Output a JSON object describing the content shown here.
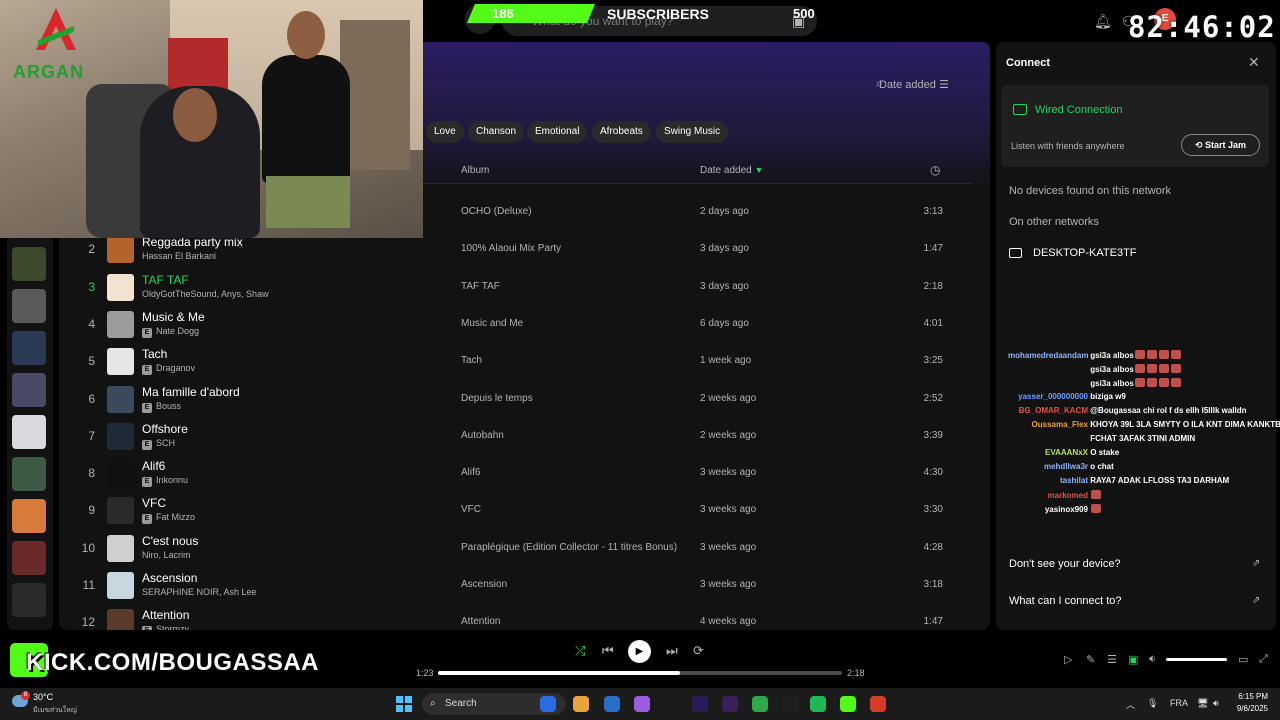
{
  "search": {
    "placeholder": "What do you want to play?"
  },
  "library_thumbs": [
    "#3b4a2a",
    "#5a5a5a",
    "#2c3b55",
    "#4a4a66",
    "#d9d9e0",
    "#3d5a45",
    "#d87a3a",
    "#6a2a2a",
    "#2a2a2a"
  ],
  "main": {
    "sort_label": "Date added",
    "chips": [
      "Love",
      "Chanson",
      "Emotional",
      "Afrobeats",
      "Swing Music"
    ],
    "columns": {
      "album": "Album",
      "date_added": "Date added"
    },
    "tracks": [
      {
        "num": "1",
        "title": "",
        "artist": "",
        "explicit": false,
        "album": "OCHO (Deluxe)",
        "added": "2 days ago",
        "duration": "3:13",
        "cover": "#555"
      },
      {
        "num": "2",
        "title": "Reggada party mix",
        "artist": "Hassan El Barkani",
        "explicit": false,
        "album": "100% Alaoui Mix Party",
        "added": "3 days ago",
        "duration": "1:47",
        "cover": "#b3642a"
      },
      {
        "num": "3",
        "title": "TAF TAF",
        "artist": "OldyGotTheSound, Anys, Shaw",
        "explicit": false,
        "album": "TAF TAF",
        "added": "3 days ago",
        "duration": "2:18",
        "cover": "#f2e2d0",
        "playing": true
      },
      {
        "num": "4",
        "title": "Music & Me",
        "artist": "Nate Dogg",
        "explicit": true,
        "album": "Music and Me",
        "added": "6 days ago",
        "duration": "4:01",
        "cover": "#9b9b9b"
      },
      {
        "num": "5",
        "title": "Tach",
        "artist": "Draganov",
        "explicit": true,
        "album": "Tach",
        "added": "1 week ago",
        "duration": "3:25",
        "cover": "#e6e6e6"
      },
      {
        "num": "6",
        "title": "Ma famille d'abord",
        "artist": "Bouss",
        "explicit": true,
        "album": "Depuis le temps",
        "added": "2 weeks ago",
        "duration": "2:52",
        "cover": "#3a4a5a"
      },
      {
        "num": "7",
        "title": "Offshore",
        "artist": "SCH",
        "explicit": true,
        "album": "Autobahn",
        "added": "2 weeks ago",
        "duration": "3:39",
        "cover": "#1e2a36"
      },
      {
        "num": "8",
        "title": "Alif6",
        "artist": "Inkonnu",
        "explicit": true,
        "album": "Alif6",
        "added": "3 weeks ago",
        "duration": "4:30",
        "cover": "#111111"
      },
      {
        "num": "9",
        "title": "VFC",
        "artist": "Fat Mizzo",
        "explicit": true,
        "album": "VFC",
        "added": "3 weeks ago",
        "duration": "3:30",
        "cover": "#2a2a2a"
      },
      {
        "num": "10",
        "title": "C'est nous",
        "artist": "Niro, Lacrim",
        "explicit": false,
        "album": "Paraplégique (Edition Collector - 11 titres Bonus)",
        "added": "3 weeks ago",
        "duration": "4:28",
        "cover": "#d0d0d0"
      },
      {
        "num": "11",
        "title": "Ascension",
        "artist": "SERAPHINE NOIR, Ash Lee",
        "explicit": false,
        "album": "Ascension",
        "added": "3 weeks ago",
        "duration": "3:18",
        "cover": "#c8d6e0"
      },
      {
        "num": "12",
        "title": "Attention",
        "artist": "Stormzy",
        "explicit": true,
        "album": "Attention",
        "added": "4 weeks ago",
        "duration": "1:47",
        "cover": "#5a3a2a"
      }
    ]
  },
  "connect": {
    "title": "Connect",
    "wired": "Wired Connection",
    "listen": "Listen with friends anywhere",
    "jam": "Start Jam",
    "no_devices": "No devices found on this network",
    "other": "On other networks",
    "device": "DESKTOP-KATE3TF",
    "help1": "Don't see your device?",
    "help2": "What can I connect to?"
  },
  "chat": [
    {
      "user": "mohamedredaandam",
      "color": "#8fb4ff",
      "text": "gsi3a albos",
      "emotes": 4
    },
    {
      "user": "",
      "color": "#8fb4ff",
      "text": "gsi3a albos",
      "emotes": 4
    },
    {
      "user": "",
      "color": "#8fb4ff",
      "text": "gsi3a albos",
      "emotes": 4
    },
    {
      "user": "yasser_000000000",
      "color": "#6aa0ff",
      "text": "biziga w9",
      "emotes": 0
    },
    {
      "user": "BG_OMAR_KACM",
      "color": "#e0524b",
      "text": "@Bougassaa chi rol f ds ellh l5lllk walldn",
      "emotes": 0
    },
    {
      "user": "Oussama_Flex",
      "color": "#f0a030",
      "text": "KHOYA 39L 3LA SMYTY O ILA KNT DIMA KANKTB",
      "emotes": 0
    },
    {
      "user": "",
      "color": "#f0a030",
      "text": "FCHAT 3AFAK 3TINI ADMIN",
      "emotes": 0
    },
    {
      "user": "EVAAANxX",
      "color": "#b4e05a",
      "text": "O stake",
      "emotes": 0
    },
    {
      "user": "mehdllwa3r",
      "color": "#8fb4ff",
      "text": "o chat",
      "emotes": 0
    },
    {
      "user": "tashilat",
      "color": "#8fb4ff",
      "text": "RAYA7 ADAK LFLOSS TA3 DARHAM",
      "emotes": 0
    },
    {
      "user": "markomed",
      "color": "#e0524b",
      "text": "",
      "emotes": 1
    },
    {
      "user": "yasinox909",
      "color": "#ffffff",
      "text": "",
      "emotes": 1
    }
  ],
  "player": {
    "elapsed": "1:23",
    "total": "2:18",
    "progress": 0.6,
    "volume": 1.0
  },
  "taskbar": {
    "temp": "30°C",
    "weather_sub": "มีเมฆส่วนใหญ่",
    "search": "Search",
    "lang": "FRA",
    "time": "6:15 PM",
    "date": "9/6/2025",
    "apps": [
      "#2b6de0",
      "#e8a33a",
      "#2a6fc7",
      "#9c5ce0",
      "#2d1a5a",
      "#3a1f5a",
      "#2fa84a",
      "#1e1e1e",
      "#1db954",
      "#53fc18",
      "#d93a2a"
    ]
  },
  "overlay": {
    "logo_text": "ARGAN",
    "sub_count": "186",
    "sub_label": "SUBSCRIBERS",
    "sub_goal": "500",
    "sub_fraction": 0.37,
    "timer": "82:46:02",
    "kick": "KICK.COM/BOUGASSAA"
  }
}
